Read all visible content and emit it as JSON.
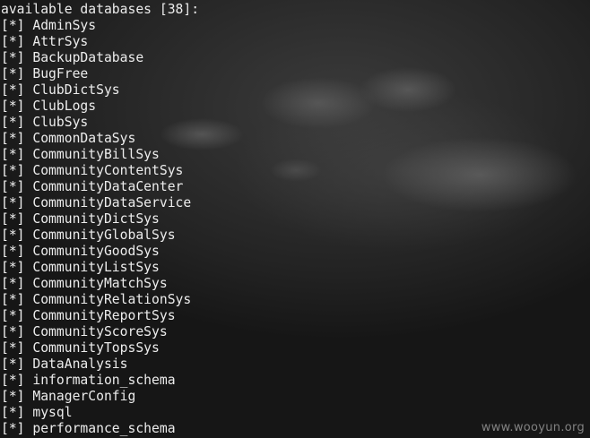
{
  "header": "available databases [38]:",
  "bullet": "[*]",
  "databases": [
    "AdminSys",
    "AttrSys",
    "BackupDatabase",
    "BugFree",
    "ClubDictSys",
    "ClubLogs",
    "ClubSys",
    "CommonDataSys",
    "CommunityBillSys",
    "CommunityContentSys",
    "CommunityDataCenter",
    "CommunityDataService",
    "CommunityDictSys",
    "CommunityGlobalSys",
    "CommunityGoodSys",
    "CommunityListSys",
    "CommunityMatchSys",
    "CommunityRelationSys",
    "CommunityReportSys",
    "CommunityScoreSys",
    "CommunityTopsSys",
    "DataAnalysis",
    "information_schema",
    "ManagerConfig",
    "mysql",
    "performance_schema"
  ],
  "watermark": "www.wooyun.org"
}
